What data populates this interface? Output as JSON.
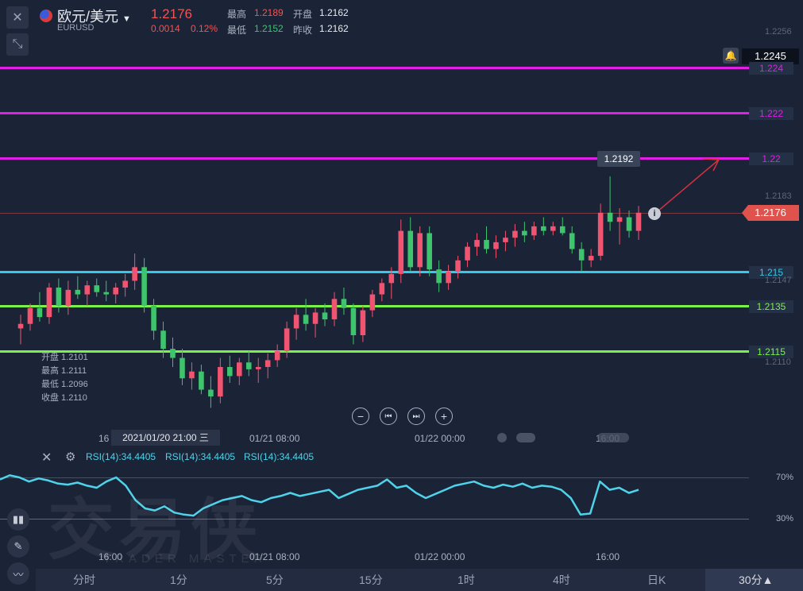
{
  "header": {
    "symbol_name": "欧元/美元",
    "symbol_code": "EURUSD",
    "last_price": "1.2176",
    "change": "0.0014",
    "change_pct": "0.12%",
    "high_label": "最高",
    "high_value": "1.2189",
    "low_label": "最低",
    "low_value": "1.2152",
    "open_label": "开盘",
    "open_value": "1.2162",
    "prev_close_label": "昨收",
    "prev_close_value": "1.2162"
  },
  "price_axis": {
    "top": "1.2256",
    "marker_1_2245": "1.2245",
    "level_1_224": "1.224",
    "level_1_222": "1.222",
    "level_1_22": "1.22",
    "tick_1_2183": "1.2183",
    "current": "1.2176",
    "level_1_215": "1.215",
    "tick_1_2147": "1.2147",
    "level_1_2135": "1.2135",
    "level_1_2115": "1.2115",
    "tick_1_2110": "1.2110"
  },
  "tooltip_peak": "1.2192",
  "ohlc_box": {
    "open": "开盘 1.2101",
    "high": "最高 1.2111",
    "low": "最低 1.2096",
    "close": "收盘 1.2110"
  },
  "x_axis": {
    "crosshair_label": "2021/01/20 21:00 三",
    "left_label": "16",
    "t1": "01/21 08:00",
    "t2": "01/22 00:00",
    "t3": "16:00"
  },
  "rsi": {
    "label_1": "RSI(14):34.4405",
    "label_2": "RSI(14):34.4405",
    "label_3": "RSI(14):34.4405",
    "level_70": "70%",
    "level_30": "30%",
    "x1": "16:00",
    "x2": "01/21 08:00",
    "x3": "01/22 00:00",
    "x4": "16:00"
  },
  "timeframes": [
    "分时",
    "1分",
    "5分",
    "15分",
    "1时",
    "4时",
    "日K",
    "30分▲"
  ],
  "watermark": {
    "main": "交易侠",
    "sub": "TRADER MASTER"
  },
  "colors": {
    "magenta": "#e11ee6",
    "cyan": "#35c8e8",
    "green": "#7cf14a",
    "up": "#f05470",
    "down": "#3ec46d",
    "rsi": "#4fd3ea"
  },
  "chart_data": {
    "type": "candlestick",
    "ylim": [
      1.2096,
      1.2256
    ],
    "horizontal_levels": [
      1.224,
      1.222,
      1.22,
      1.215,
      1.2135,
      1.2115
    ],
    "candles": [
      [
        1.2125,
        1.2131,
        1.2118,
        1.2127
      ],
      [
        1.2127,
        1.2136,
        1.2124,
        1.2134
      ],
      [
        1.2134,
        1.2141,
        1.2128,
        1.213
      ],
      [
        1.213,
        1.2145,
        1.2127,
        1.2143
      ],
      [
        1.2143,
        1.2147,
        1.2132,
        1.2135
      ],
      [
        1.2135,
        1.2146,
        1.2131,
        1.2142
      ],
      [
        1.2142,
        1.2148,
        1.2138,
        1.214
      ],
      [
        1.214,
        1.2146,
        1.2135,
        1.2144
      ],
      [
        1.2144,
        1.2147,
        1.2139,
        1.2141
      ],
      [
        1.2141,
        1.2146,
        1.2137,
        1.214
      ],
      [
        1.214,
        1.2145,
        1.2136,
        1.2143
      ],
      [
        1.2143,
        1.2149,
        1.2139,
        1.2146
      ],
      [
        1.2146,
        1.2158,
        1.2142,
        1.2152
      ],
      [
        1.2152,
        1.2156,
        1.2132,
        1.2135
      ],
      [
        1.2135,
        1.2138,
        1.212,
        1.2124
      ],
      [
        1.2124,
        1.2128,
        1.2112,
        1.2116
      ],
      [
        1.2116,
        1.2121,
        1.2108,
        1.2112
      ],
      [
        1.2112,
        1.2116,
        1.21,
        1.2103
      ],
      [
        1.2103,
        1.211,
        1.2098,
        1.2106
      ],
      [
        1.2106,
        1.2109,
        1.2096,
        1.2098
      ],
      [
        1.2098,
        1.2104,
        1.209,
        1.2095
      ],
      [
        1.2095,
        1.2112,
        1.2092,
        1.2108
      ],
      [
        1.2108,
        1.2113,
        1.2101,
        1.2104
      ],
      [
        1.2104,
        1.2112,
        1.21,
        1.211
      ],
      [
        1.211,
        1.2115,
        1.2104,
        1.2107
      ],
      [
        1.2107,
        1.2112,
        1.2101,
        1.2108
      ],
      [
        1.2108,
        1.2114,
        1.2103,
        1.2111
      ],
      [
        1.2111,
        1.2118,
        1.2108,
        1.2115
      ],
      [
        1.2115,
        1.2128,
        1.2112,
        1.2125
      ],
      [
        1.2125,
        1.2134,
        1.212,
        1.2131
      ],
      [
        1.2131,
        1.2138,
        1.2124,
        1.2127
      ],
      [
        1.2127,
        1.2134,
        1.2121,
        1.2132
      ],
      [
        1.2132,
        1.2136,
        1.2126,
        1.2129
      ],
      [
        1.2129,
        1.2141,
        1.2126,
        1.2138
      ],
      [
        1.2138,
        1.2143,
        1.2131,
        1.2134
      ],
      [
        1.2134,
        1.2136,
        1.2118,
        1.2122
      ],
      [
        1.2122,
        1.2135,
        1.2119,
        1.2133
      ],
      [
        1.2133,
        1.2142,
        1.213,
        1.214
      ],
      [
        1.214,
        1.2147,
        1.2137,
        1.2145
      ],
      [
        1.2145,
        1.2152,
        1.2138,
        1.2149
      ],
      [
        1.2149,
        1.2173,
        1.2145,
        1.2168
      ],
      [
        1.2168,
        1.2174,
        1.215,
        1.2152
      ],
      [
        1.2152,
        1.217,
        1.2148,
        1.2167
      ],
      [
        1.2167,
        1.217,
        1.2148,
        1.2151
      ],
      [
        1.2151,
        1.2155,
        1.2141,
        1.2145
      ],
      [
        1.2145,
        1.2153,
        1.2142,
        1.215
      ],
      [
        1.215,
        1.2157,
        1.2147,
        1.2155
      ],
      [
        1.2155,
        1.2163,
        1.2152,
        1.2161
      ],
      [
        1.2161,
        1.2167,
        1.2157,
        1.2164
      ],
      [
        1.2164,
        1.217,
        1.2158,
        1.216
      ],
      [
        1.216,
        1.2166,
        1.2156,
        1.2163
      ],
      [
        1.2163,
        1.2168,
        1.2159,
        1.2165
      ],
      [
        1.2165,
        1.2171,
        1.2161,
        1.2168
      ],
      [
        1.2168,
        1.2172,
        1.2163,
        1.2166
      ],
      [
        1.2166,
        1.2172,
        1.2164,
        1.217
      ],
      [
        1.217,
        1.2174,
        1.2166,
        1.2168
      ],
      [
        1.2168,
        1.2172,
        1.2166,
        1.217
      ],
      [
        1.217,
        1.2174,
        1.2166,
        1.2167
      ],
      [
        1.2167,
        1.217,
        1.2158,
        1.216
      ],
      [
        1.216,
        1.2163,
        1.215,
        1.2155
      ],
      [
        1.2155,
        1.216,
        1.2152,
        1.2157
      ],
      [
        1.2157,
        1.218,
        1.2155,
        1.2176
      ],
      [
        1.2176,
        1.2192,
        1.2168,
        1.2172
      ],
      [
        1.2172,
        1.2178,
        1.2162,
        1.2174
      ],
      [
        1.2174,
        1.2177,
        1.2165,
        1.2168
      ],
      [
        1.2168,
        1.2179,
        1.2164,
        1.2176
      ]
    ],
    "rsi_values": [
      68,
      72,
      70,
      66,
      69,
      67,
      64,
      63,
      65,
      62,
      60,
      66,
      70,
      62,
      48,
      40,
      38,
      42,
      36,
      34,
      33,
      40,
      44,
      48,
      50,
      52,
      48,
      46,
      50,
      52,
      55,
      52,
      54,
      56,
      58,
      50,
      54,
      58,
      60,
      62,
      68,
      60,
      62,
      55,
      50,
      54,
      58,
      62,
      64,
      66,
      62,
      60,
      63,
      61,
      64,
      60,
      62,
      61,
      58,
      50,
      34,
      35,
      66,
      58,
      60,
      55,
      58
    ]
  }
}
